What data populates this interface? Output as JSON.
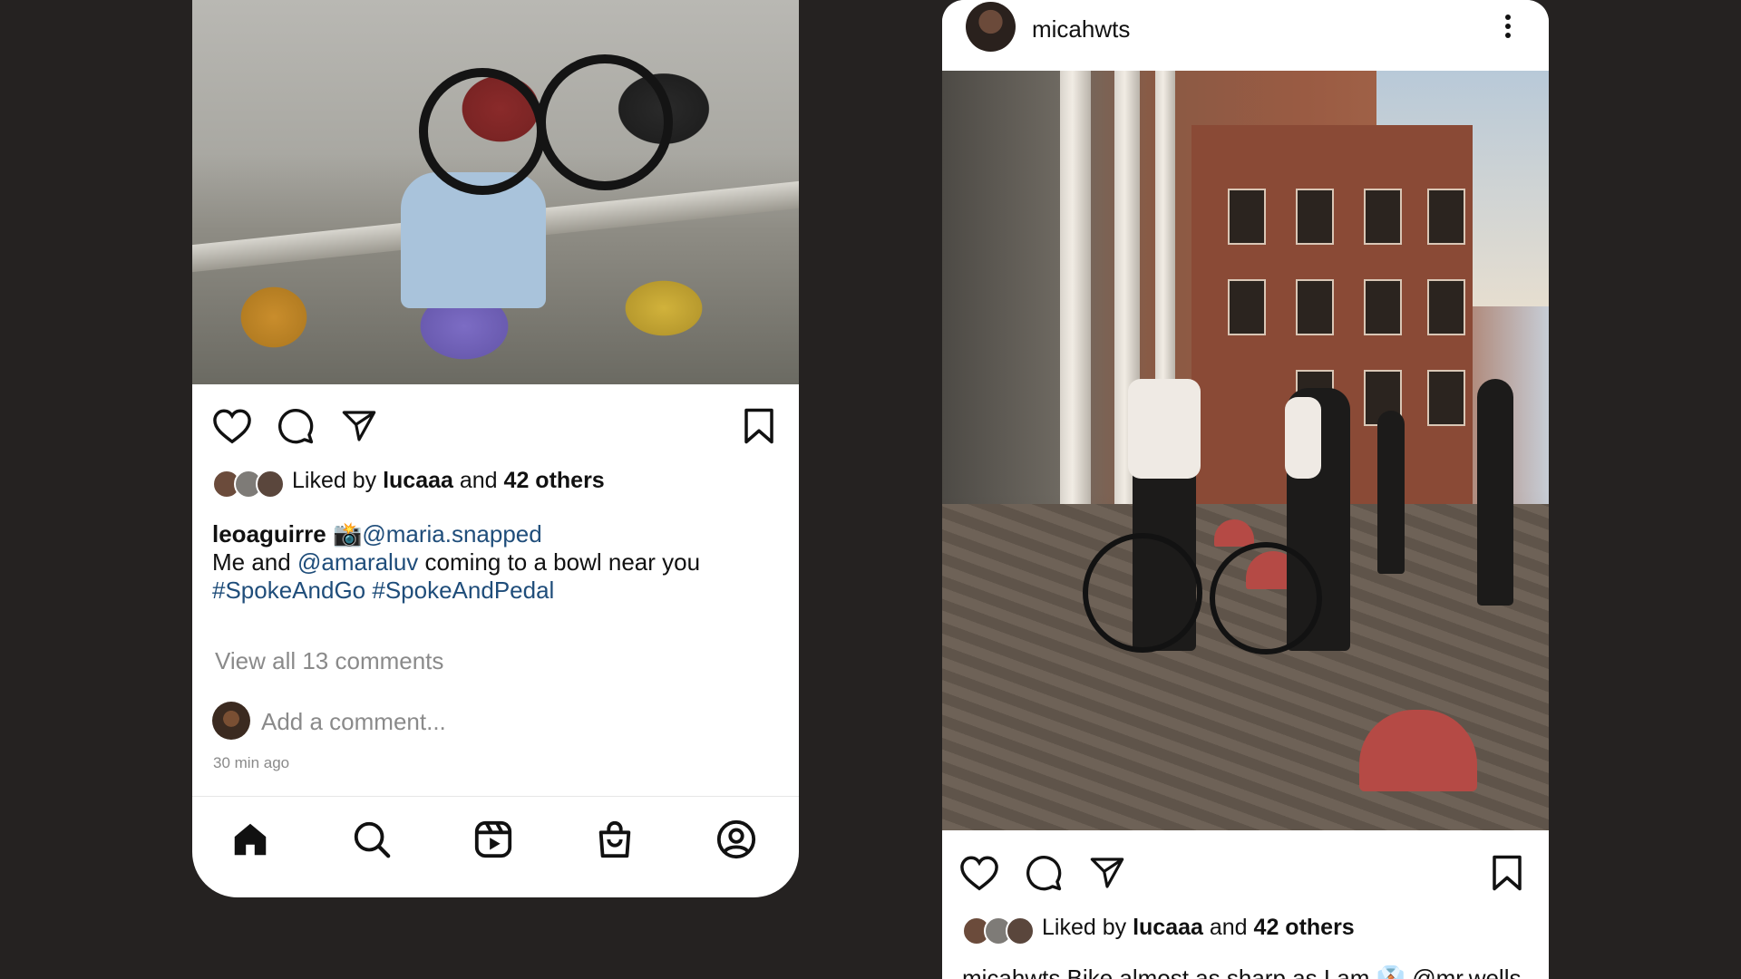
{
  "left_post": {
    "likes": {
      "prefix": "Liked by",
      "user": "lucaaa",
      "and": "and",
      "others": "42 others"
    },
    "caption": {
      "username": "leoaguirre",
      "camera_emoji": "📸",
      "credit": "@maria.snapped",
      "line2_prefix": "Me and",
      "mention": "@amaraluv",
      "line2_suffix": "coming to a bowl near you",
      "hashtag1": "#SpokeAndGo",
      "hashtag2": "#SpokeAndPedal"
    },
    "view_all_comments": "View all 13 comments",
    "comment_placeholder": "Add a comment...",
    "time_ago": "30 min ago"
  },
  "right_post": {
    "username": "micahwts",
    "likes": {
      "prefix": "Liked by",
      "user": "lucaaa",
      "and": "and",
      "others": "42 others"
    },
    "caption_partial": "micahwts Bike almost as sharp as I am 👔 @mr.wells"
  },
  "icons": {
    "like": "heart-icon",
    "comment": "comment-icon",
    "share": "send-icon",
    "save": "bookmark-icon",
    "more": "more-vertical-icon",
    "nav": [
      "home-icon",
      "search-icon",
      "reels-icon",
      "shop-icon",
      "profile-icon"
    ]
  },
  "colors": {
    "background": "#252221",
    "card": "#ffffff",
    "link": "#1f4d7a",
    "muted": "#8a8a8a"
  }
}
